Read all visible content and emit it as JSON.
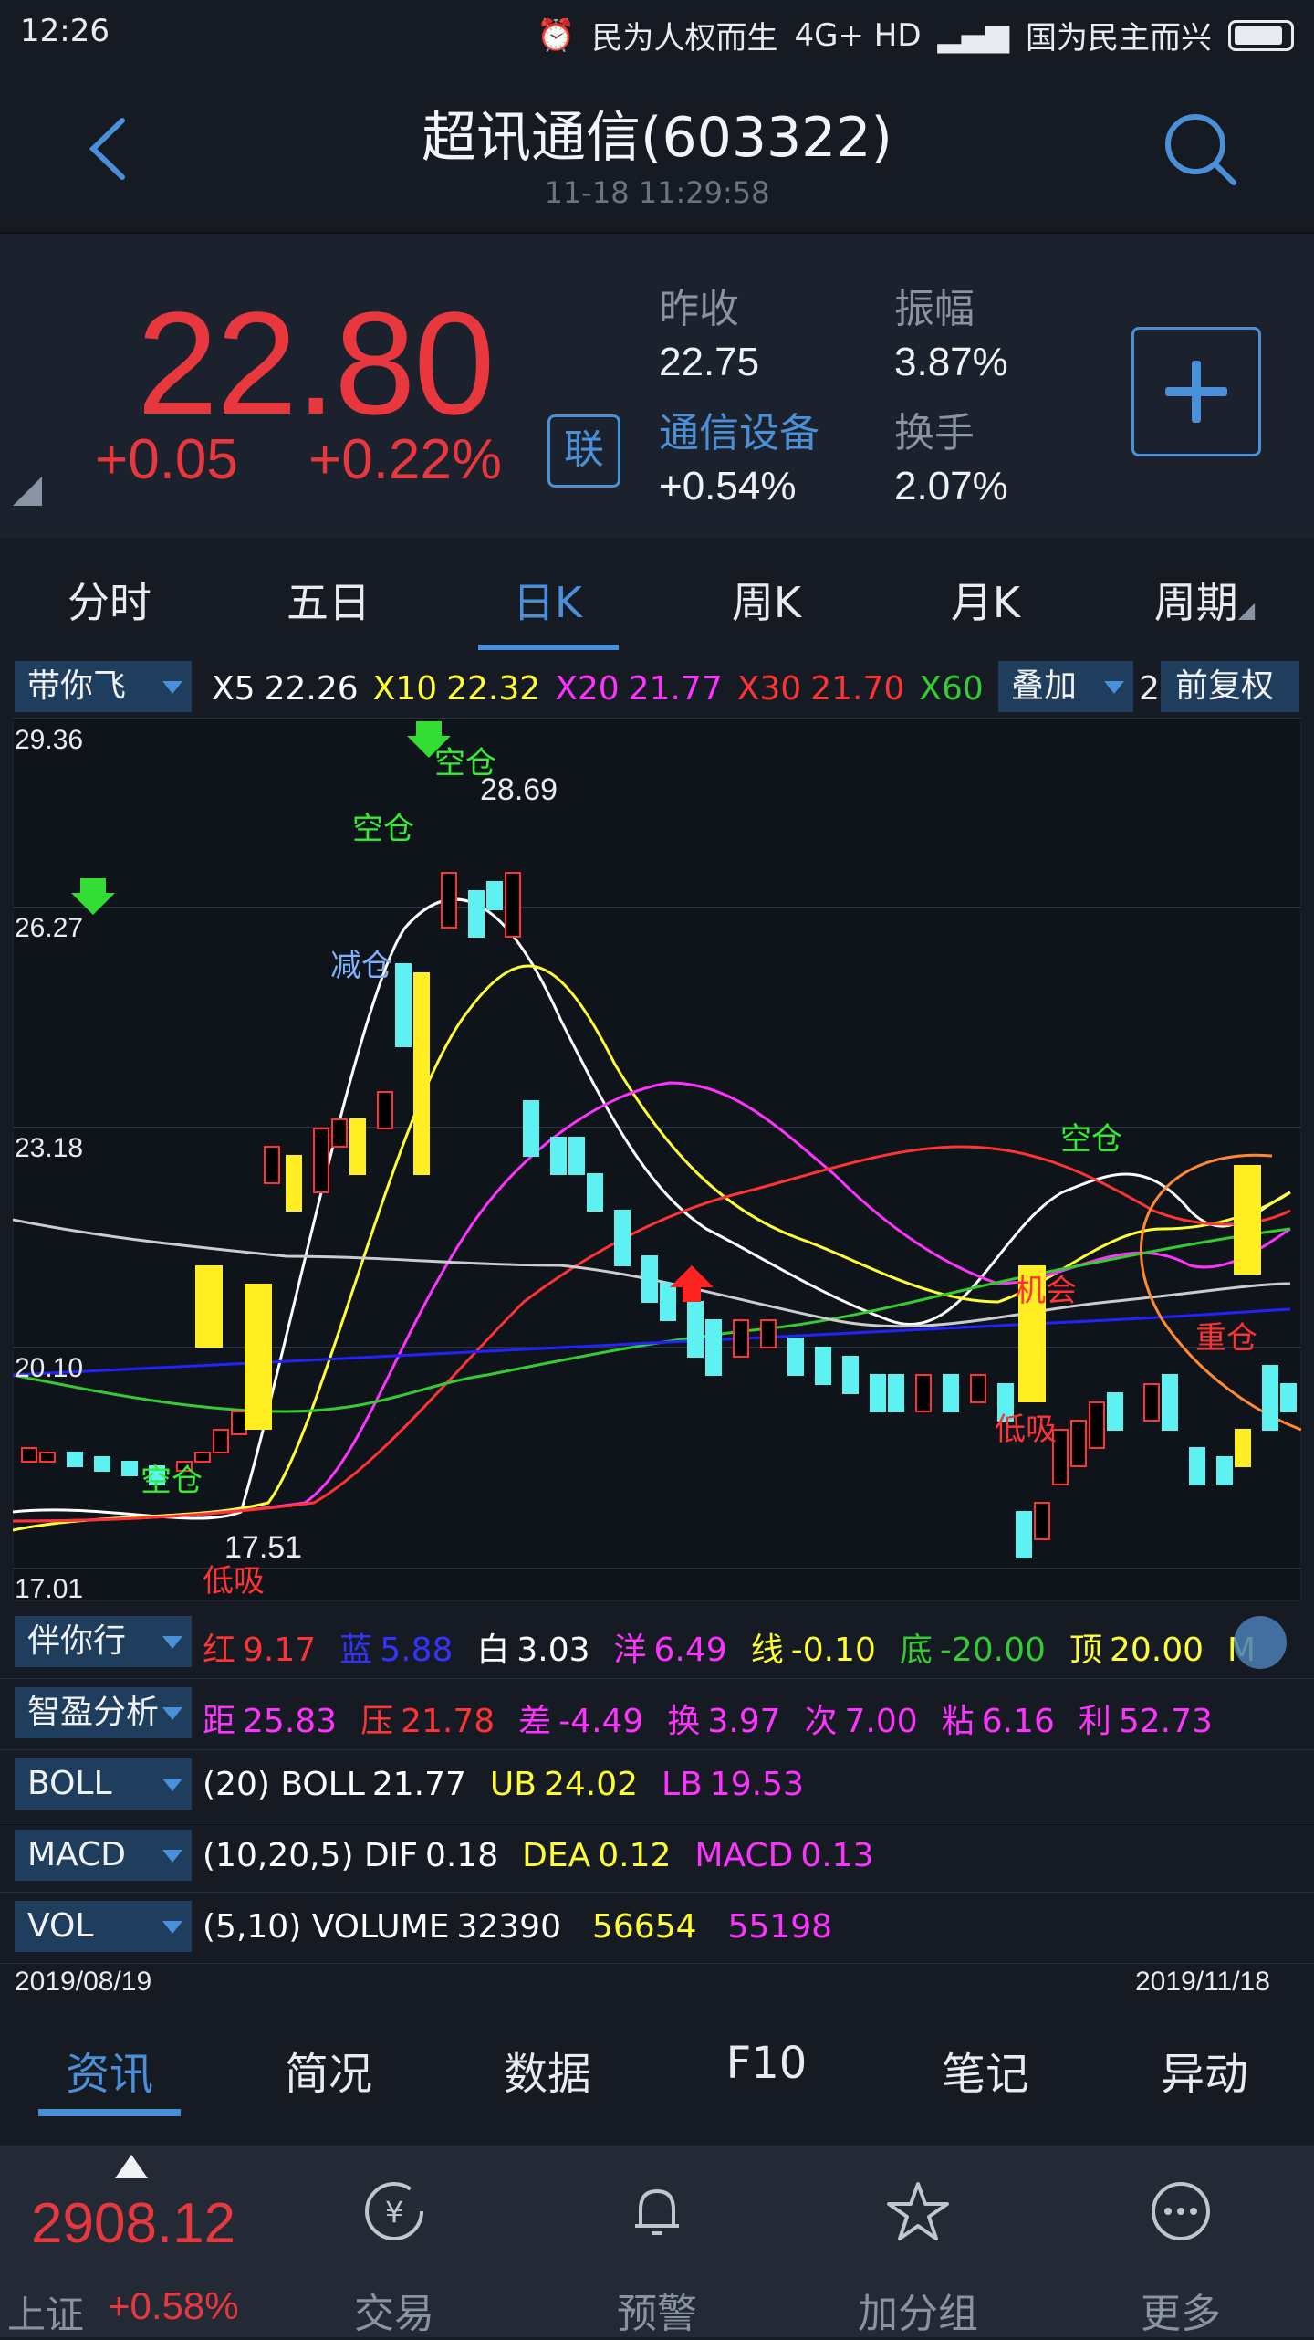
{
  "status_bar": {
    "time": "12:26",
    "carrier1": "民为人权而生",
    "network": "4G+ HD",
    "carrier2": "国为民主而兴"
  },
  "header": {
    "title": "超讯通信(603322)",
    "timestamp": "11-18 11:29:58"
  },
  "quote": {
    "price": "22.80",
    "change": "+0.05",
    "change_pct": "+0.22%",
    "lian_label": "联",
    "prev_close_label": "昨收",
    "prev_close": "22.75",
    "amplitude_label": "振幅",
    "amplitude": "3.87%",
    "sector_label": "通信设备",
    "sector_change": "+0.54%",
    "turnover_label": "换手",
    "turnover": "2.07%"
  },
  "period_tabs": [
    "分时",
    "五日",
    "日K",
    "周K",
    "月K",
    "周期"
  ],
  "active_period": "日K",
  "ma_bar": {
    "selector": "带你飞",
    "items": [
      {
        "name": "X5",
        "value": "22.26",
        "color": "#ffffff"
      },
      {
        "name": "X10",
        "value": "22.32",
        "color": "#ffff33"
      },
      {
        "name": "X20",
        "value": "21.77",
        "color": "#ff33ff"
      },
      {
        "name": "X30",
        "value": "21.70",
        "color": "#ff3333"
      },
      {
        "name": "X60",
        "value": "",
        "color": "#33cc33"
      }
    ],
    "overlay_label": "叠加",
    "overlay_tail": "2",
    "adjust_label": "前复权"
  },
  "chart_data": {
    "type": "candlestick",
    "y_ticks": [
      "29.36",
      "26.27",
      "23.18",
      "20.10",
      "17.01"
    ],
    "high_label": "28.69",
    "low_label": "17.51",
    "signals": {
      "empty": "空仓",
      "reduce": "减仓",
      "low_buy": "低吸",
      "chance": "机会",
      "heavy": "重仓"
    },
    "date_start": "2019/08/19",
    "date_end": "2019/11/18"
  },
  "indicators": [
    {
      "selector": "伴你行",
      "values": [
        {
          "label": "红",
          "value": "9.17",
          "color": "#ff3333"
        },
        {
          "label": "蓝",
          "value": "5.88",
          "color": "#3333ff"
        },
        {
          "label": "白",
          "value": "3.03",
          "color": "#ffffff"
        },
        {
          "label": "洋",
          "value": "6.49",
          "color": "#ff33ff"
        },
        {
          "label": "线",
          "value": "-0.10",
          "color": "#ffff33"
        },
        {
          "label": "底",
          "value": "-20.00",
          "color": "#33cc33"
        },
        {
          "label": "顶",
          "value": "20.00",
          "color": "#ffff33"
        },
        {
          "label": "M",
          "value": "",
          "color": "#ffff33"
        }
      ]
    },
    {
      "selector": "智盈分析",
      "values": [
        {
          "label": "距",
          "value": "25.83",
          "color": "#ff33ff"
        },
        {
          "label": "压",
          "value": "21.78",
          "color": "#ff3333"
        },
        {
          "label": "差",
          "value": "-4.49",
          "color": "#ff33ff"
        },
        {
          "label": "换",
          "value": "3.97",
          "color": "#ff33ff"
        },
        {
          "label": "次",
          "value": "7.00",
          "color": "#ff33ff"
        },
        {
          "label": "粘",
          "value": "6.16",
          "color": "#ff33ff"
        },
        {
          "label": "利",
          "value": "52.73",
          "color": "#ff33ff"
        }
      ]
    },
    {
      "selector": "BOLL",
      "values": [
        {
          "label": "(20) BOLL",
          "value": "21.77",
          "color": "#ffffff"
        },
        {
          "label": "UB",
          "value": "24.02",
          "color": "#ffff33"
        },
        {
          "label": "LB",
          "value": "19.53",
          "color": "#ff33ff"
        }
      ]
    },
    {
      "selector": "MACD",
      "values": [
        {
          "label": "(10,20,5) DIF",
          "value": "0.18",
          "color": "#ffffff"
        },
        {
          "label": "DEA",
          "value": "0.12",
          "color": "#ffff33"
        },
        {
          "label": "MACD",
          "value": "0.13",
          "color": "#ff33ff"
        }
      ]
    },
    {
      "selector": "VOL",
      "values": [
        {
          "label": "(5,10) VOLUME",
          "value": "32390",
          "color": "#ffffff"
        },
        {
          "label": "",
          "value": "56654",
          "color": "#ffff33"
        },
        {
          "label": "",
          "value": "55198",
          "color": "#ff33ff"
        }
      ]
    }
  ],
  "content_tabs": [
    "资讯",
    "简况",
    "数据",
    "F10",
    "笔记",
    "异动"
  ],
  "bottom_nav": {
    "index_value": "2908.12",
    "index_name": "上证",
    "index_change": "+0.58%",
    "items": [
      {
        "label": "交易",
        "icon": "yen-circle-icon"
      },
      {
        "label": "预警",
        "icon": "bell-icon"
      },
      {
        "label": "加分组",
        "icon": "star-icon"
      },
      {
        "label": "更多",
        "icon": "more-dots-icon"
      }
    ]
  }
}
